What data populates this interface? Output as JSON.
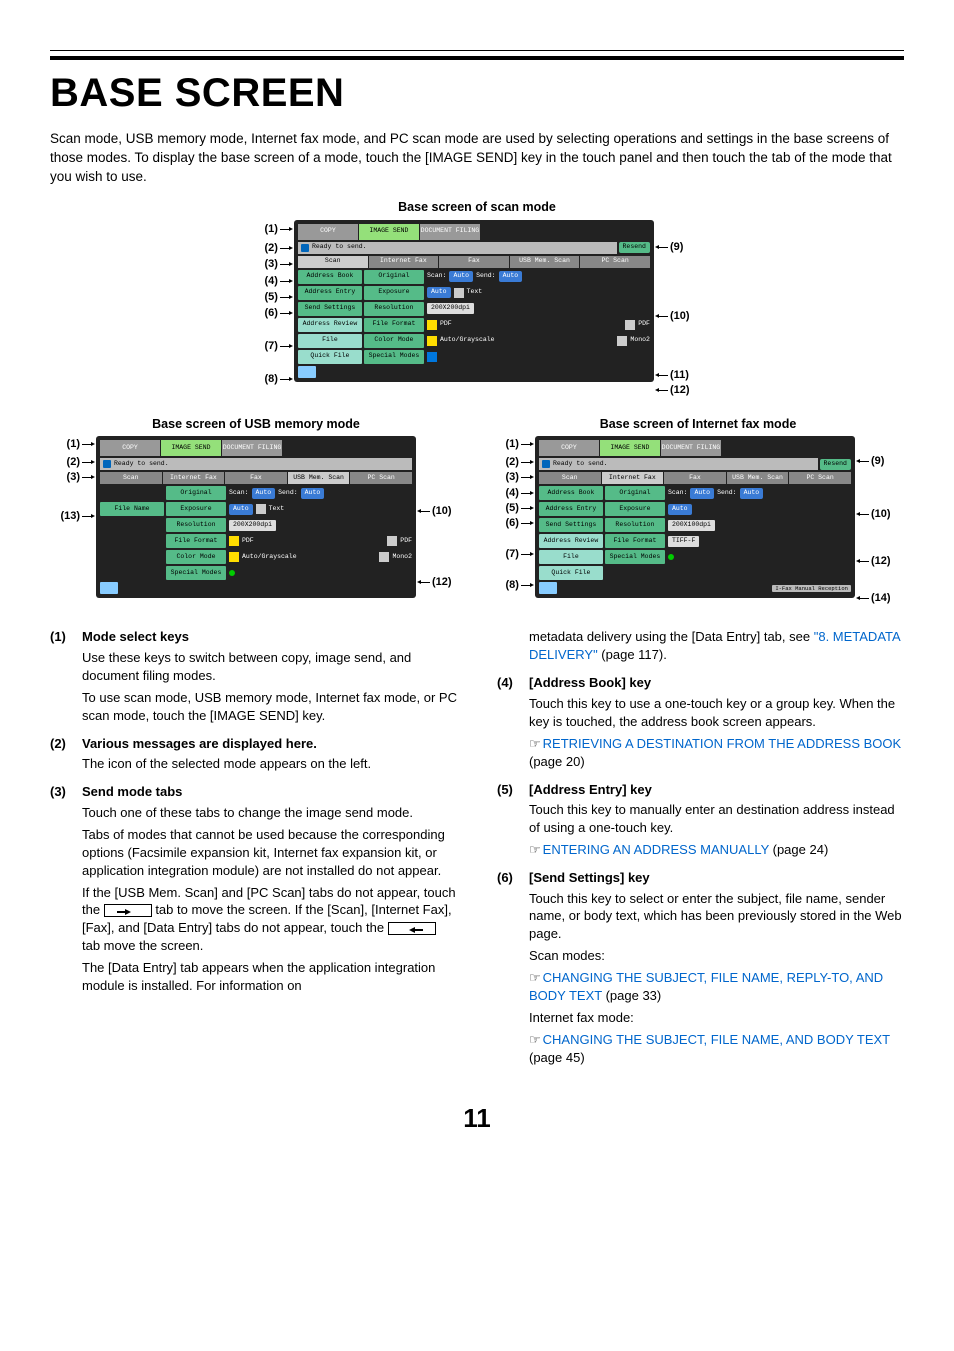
{
  "page_number": "11",
  "title": "BASE SCREEN",
  "intro": "Scan mode, USB memory mode, Internet fax mode, and PC scan mode are used by selecting operations and settings in the base screens of those modes. To display the base screen of a mode, touch the [IMAGE SEND] key in the touch panel and then touch the tab of the mode that you wish to use.",
  "caption_scan": "Base screen of scan mode",
  "caption_usb": "Base screen of USB memory mode",
  "caption_ifax": "Base screen of Internet fax mode",
  "mode_tabs": {
    "copy": "COPY",
    "image_send": "IMAGE SEND",
    "doc_filing": "DOCUMENT FILING"
  },
  "status_text": "Ready to send.",
  "resend": "Resend",
  "send_tabs": {
    "scan": "Scan",
    "ifax": "Internet Fax",
    "fax": "Fax",
    "usb": "USB Mem. Scan",
    "pc": "PC Scan"
  },
  "side": {
    "address_book": "Address Book",
    "address_entry": "Address Entry",
    "send_settings": "Send Settings",
    "address_review": "Address Review",
    "file": "File",
    "quick_file": "Quick File",
    "file_name": "File Name"
  },
  "center": {
    "original": "Original",
    "exposure": "Exposure",
    "resolution": "Resolution",
    "file_format": "File Format",
    "color_mode": "Color Mode",
    "special_modes": "Special Modes",
    "scan_label": "Scan:",
    "send_label": "Send:",
    "auto": "Auto",
    "text_mode": "Text",
    "res_200": "200X200dpi",
    "res_100": "200X100dpi",
    "pdf": "PDF",
    "tiff_f": "TIFF-F",
    "auto_gray": "Auto/Grayscale",
    "mono2": "Mono2"
  },
  "ifax_manual": "I-Fax Manual Reception",
  "callouts": {
    "1": "(1)",
    "2": "(2)",
    "3": "(3)",
    "4": "(4)",
    "5": "(5)",
    "6": "(6)",
    "7": "(7)",
    "8": "(8)",
    "9": "(9)",
    "10": "(10)",
    "11": "(11)",
    "12": "(12)",
    "13": "(13)",
    "14": "(14)"
  },
  "desc": {
    "1": {
      "title": "Mode select keys",
      "body1": "Use these keys to switch between copy, image send, and document filing modes.",
      "body2": "To use scan mode, USB memory mode, Internet fax mode, or PC scan mode, touch the [IMAGE SEND] key."
    },
    "2": {
      "title": "Various messages are displayed here.",
      "body1": "The icon of the selected mode appears on the left."
    },
    "3": {
      "title": "Send mode tabs",
      "body1": "Touch one of these tabs to change the image send mode.",
      "body2": "Tabs of modes that cannot be used because the corresponding options (Facsimile expansion kit, Internet fax expansion kit, or application integration module) are not installed do not appear.",
      "body3a": "If the [USB Mem. Scan] and [PC Scan] tabs do not appear, touch the ",
      "body3b": " tab to move the screen. If the [Scan], [Internet Fax], [Fax], and [Data Entry] tabs do not appear, touch the ",
      "body3c": " tab move the screen.",
      "body4a": "The [Data Entry] tab appears when the application integration module is installed. For information on",
      "body4b": "metadata delivery using the [Data Entry] tab, see ",
      "link4": "\"8. METADATA DELIVERY\"",
      "page4": " (page 117)."
    },
    "4": {
      "title": "[Address Book] key",
      "body1": "Touch this key to use a one-touch key or a group key. When the key is touched, the address book screen appears.",
      "link": "RETRIEVING A DESTINATION FROM THE ADDRESS BOOK",
      "page": " (page 20)"
    },
    "5": {
      "title": "[Address Entry] key",
      "body1": "Touch this key to manually enter an destination address instead of using a one-touch key.",
      "link": "ENTERING AN ADDRESS MANUALLY",
      "page": " (page 24)"
    },
    "6": {
      "title": "[Send Settings] key",
      "body1": "Touch this key to select or enter the subject, file name, sender name, or body text, which has been previously stored in the Web page.",
      "scan_label": "Scan modes:",
      "scan_link": "CHANGING THE SUBJECT, FILE NAME, REPLY-TO, AND BODY TEXT",
      "scan_page": " (page 33)",
      "ifax_label": "Internet fax mode:",
      "ifax_link": "CHANGING THE SUBJECT, FILE NAME, AND BODY TEXT",
      "ifax_page": " (page 45)"
    }
  }
}
